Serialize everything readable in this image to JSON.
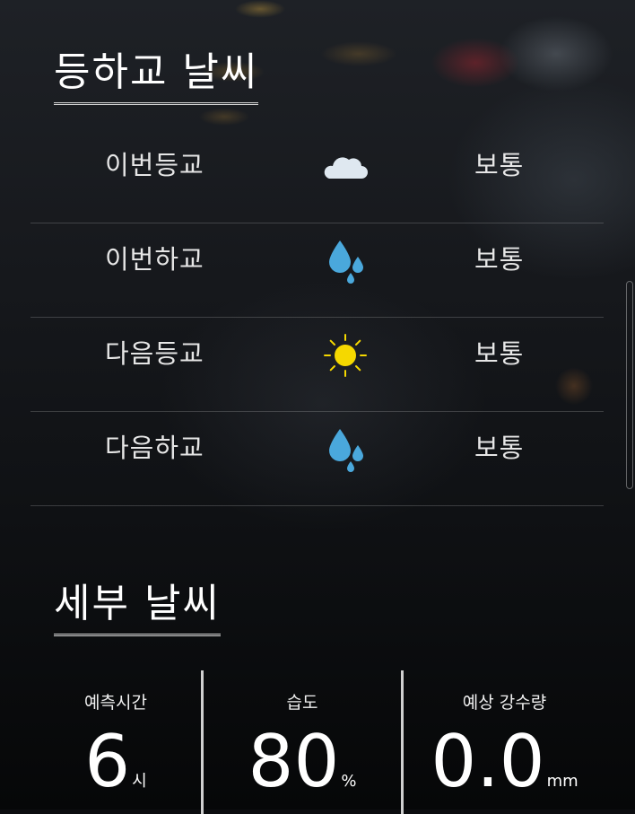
{
  "commute": {
    "title": "등하교 날씨",
    "rows": [
      {
        "label": "이번등교",
        "icon": "cloud-icon",
        "status": "보통"
      },
      {
        "label": "이번하교",
        "icon": "raindrops-icon",
        "status": "보통"
      },
      {
        "label": "다음등교",
        "icon": "sun-icon",
        "status": "보통"
      },
      {
        "label": "다음하교",
        "icon": "raindrops-icon",
        "status": "보통"
      }
    ]
  },
  "details": {
    "title": "세부 날씨",
    "forecast_time": {
      "label": "예측시간",
      "value": "6",
      "unit": "시"
    },
    "humidity": {
      "label": "습도",
      "value": "80",
      "unit": "%"
    },
    "precipitation": {
      "label": "예상 강수량",
      "value": "0.0",
      "unit": "mm"
    }
  },
  "colors": {
    "rain": "#4aa8dc",
    "sun": "#f5d800",
    "cloud": "#dfe8f0"
  }
}
